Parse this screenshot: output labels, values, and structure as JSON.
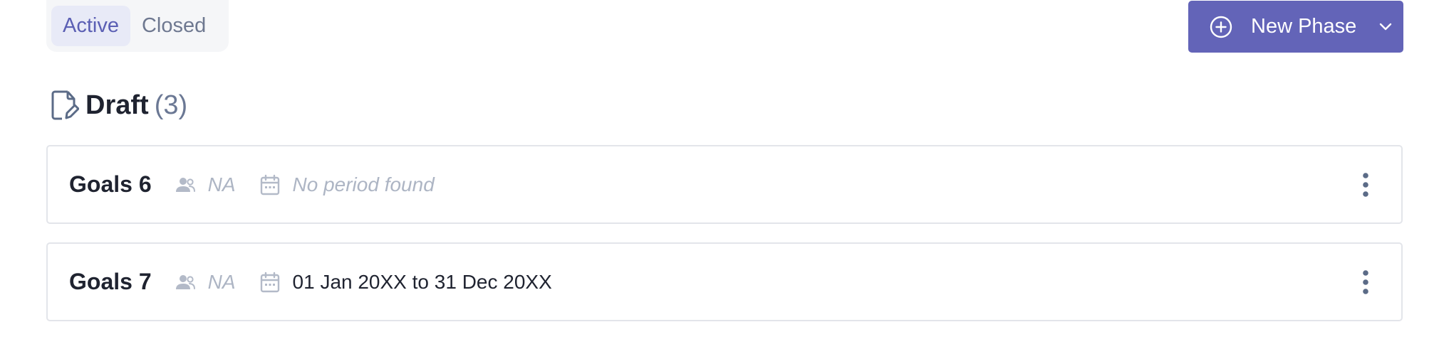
{
  "tabs": [
    {
      "label": "Active",
      "selected": true
    },
    {
      "label": "Closed",
      "selected": false
    }
  ],
  "actions": {
    "new_phase_label": "New Phase",
    "new_phase_icon": "plus-circle-icon",
    "dropdown_icon": "chevron-down-icon"
  },
  "section": {
    "icon": "document-edit-icon",
    "title": "Draft",
    "count": "(3)"
  },
  "goals": [
    {
      "title": "Goals 6",
      "owner": "NA",
      "period": "No period found",
      "has_period": false
    },
    {
      "title": "Goals 7",
      "owner": "NA",
      "period": "01 Jan 20XX to 31 Dec 20XX",
      "has_period": true
    }
  ],
  "colors": {
    "accent": "#6364b8",
    "tab_active_bg": "#e8eaf7",
    "tab_active_text": "#5b5fb4",
    "muted_text": "#adb5c4",
    "card_border": "#e3e5ea"
  }
}
